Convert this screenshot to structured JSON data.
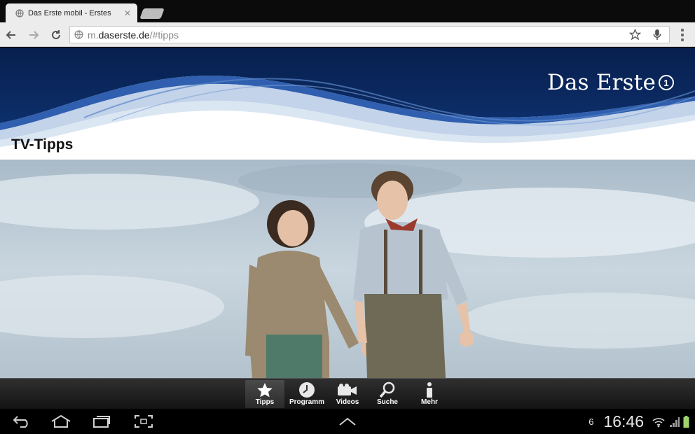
{
  "browser": {
    "tab_title": "Das Erste mobil - Erstes",
    "url_prefix": "m.",
    "url_host": "daserste.de",
    "url_path": "/#tipps"
  },
  "page": {
    "brand": "Das Erste",
    "brand_mark": "1",
    "title": "TV-Tipps",
    "nav": [
      {
        "label": "Tipps",
        "icon": "star-icon",
        "active": true
      },
      {
        "label": "Programm",
        "icon": "clock-icon",
        "active": false
      },
      {
        "label": "Videos",
        "icon": "video-camera-icon",
        "active": false
      },
      {
        "label": "Suche",
        "icon": "magnifier-icon",
        "active": false
      },
      {
        "label": "Mehr",
        "icon": "info-icon",
        "active": false
      }
    ]
  },
  "system": {
    "notification_count": "6",
    "time": "16:46"
  },
  "colors": {
    "banner_dark": "#0a2a5e",
    "banner_wave": "#2f5fae",
    "sky": "#b9c8d3"
  }
}
